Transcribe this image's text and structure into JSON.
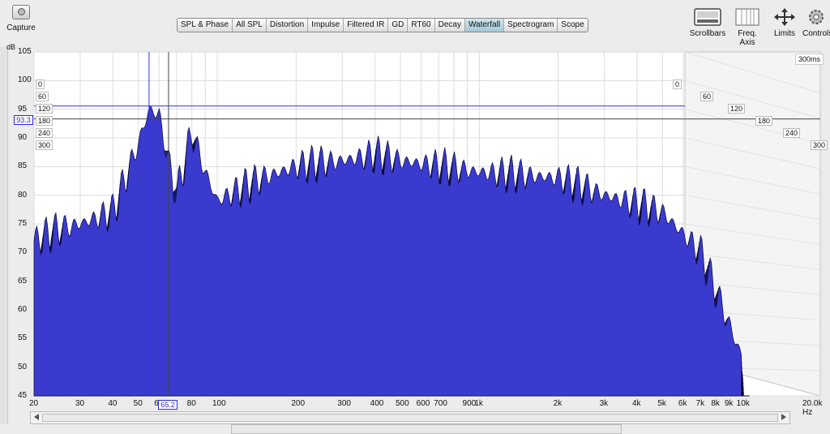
{
  "toolbar": {
    "capture_label": "Capture",
    "tabs": [
      {
        "label": "SPL & Phase"
      },
      {
        "label": "All SPL"
      },
      {
        "label": "Distortion"
      },
      {
        "label": "Impulse"
      },
      {
        "label": "Filtered IR"
      },
      {
        "label": "GD"
      },
      {
        "label": "RT60"
      },
      {
        "label": "Decay"
      },
      {
        "label": "Waterfall"
      },
      {
        "label": "Spectrogram"
      },
      {
        "label": "Scope"
      }
    ],
    "active_tab": "Waterfall",
    "scrollbars_label": "Scrollbars",
    "freq_axis_label": "Freq. Axis",
    "limits_label": "Limits",
    "controls_label": "Controls"
  },
  "chart": {
    "y_unit": "dB",
    "y_ticks": [
      "105",
      "100",
      "95",
      "90",
      "85",
      "80",
      "75",
      "70",
      "65",
      "60",
      "55",
      "50",
      "45"
    ],
    "x_ticks": [
      "20",
      "30",
      "40",
      "50",
      "60",
      "80",
      "100",
      "200",
      "300",
      "400",
      "500",
      "600",
      "700",
      "900",
      "1k",
      "2k",
      "3k",
      "4k",
      "5k",
      "6k",
      "7k",
      "8k",
      "9k",
      "10k",
      "20.0k Hz"
    ],
    "time_left": [
      "0",
      "60",
      "120",
      "180",
      "240",
      "300"
    ],
    "time_right": [
      "0",
      "60",
      "120",
      "180",
      "240",
      "300"
    ],
    "time_span_label": "300ms",
    "cursor_y": "93.3",
    "cursor_x": "65.2",
    "fill_color": "#3a3acf"
  },
  "chart_data": {
    "type": "area",
    "xlabel": "",
    "ylabel": "dB",
    "ylim": [
      45,
      105
    ],
    "xlim": [
      20,
      20000
    ],
    "x_scale": "log",
    "time_ms": [
      0,
      60,
      120,
      180,
      240,
      300
    ],
    "series": [
      {
        "x": [
          20,
          25,
          30,
          40,
          50,
          55,
          60,
          65,
          70,
          80,
          90,
          100,
          150,
          200,
          300,
          400,
          500,
          700,
          1000,
          2000,
          3000,
          5000,
          7000,
          10000
        ],
        "values": [
          72,
          74,
          75,
          77,
          89,
          95,
          94,
          86,
          80,
          91,
          84,
          79,
          83,
          85,
          86,
          87,
          86,
          85,
          84,
          83,
          80,
          77,
          70,
          52
        ]
      }
    ]
  }
}
